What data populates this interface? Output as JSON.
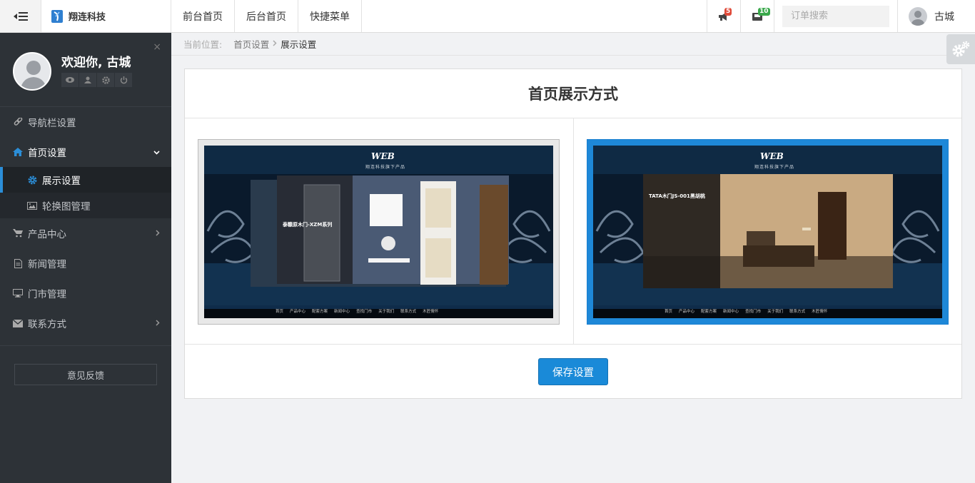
{
  "topbar": {
    "brand": "翔连科技",
    "nav": [
      "前台首页",
      "后台首页",
      "快捷菜单"
    ],
    "notify_count": "5",
    "mail_count": "10",
    "search_placeholder": "订单搜索",
    "user": "古城"
  },
  "sidebar": {
    "welcome": "欢迎你, 古城",
    "items": [
      {
        "label": "导航栏设置",
        "icon": "link-icon"
      },
      {
        "label": "首页设置",
        "icon": "home-icon",
        "open": true,
        "children": [
          {
            "label": "展示设置",
            "icon": "gear-icon",
            "active": true
          },
          {
            "label": "轮换图管理",
            "icon": "picture-icon"
          }
        ]
      },
      {
        "label": "产品中心",
        "icon": "cart-icon"
      },
      {
        "label": "新闻管理",
        "icon": "document-icon"
      },
      {
        "label": "门市管理",
        "icon": "monitor-icon"
      },
      {
        "label": "联系方式",
        "icon": "envelope-icon"
      }
    ],
    "feedback": "意见反馈"
  },
  "breadcrumb": {
    "prefix": "当前位置:",
    "parent": "首页设置",
    "current": "展示设置"
  },
  "panel": {
    "title": "首页展示方式",
    "option1": {
      "web_logo": "WEB",
      "tagline": "翔连科技旗下产品",
      "product_title": "泰糠原木门-XZM系列",
      "menu": [
        "首页",
        "产品中心",
        "配套方案",
        "新闻中心",
        "查找门市",
        "关于我们",
        "联系方式",
        "木匠情怀"
      ]
    },
    "option2": {
      "web_logo": "WEB",
      "tagline": "翔连科技旗下产品",
      "product_title": "TATA木门JS-001黑胡桃",
      "menu": [
        "首页",
        "产品中心",
        "配套方案",
        "新闻中心",
        "查找门市",
        "关于我们",
        "联系方式",
        "木匠情怀"
      ],
      "selected": true
    },
    "save_label": "保存设置"
  },
  "colors": {
    "accent": "#1a8ad8",
    "sidebar_bg": "#2d3237",
    "badge_red": "#e04b3a",
    "badge_green": "#3aa84b"
  }
}
